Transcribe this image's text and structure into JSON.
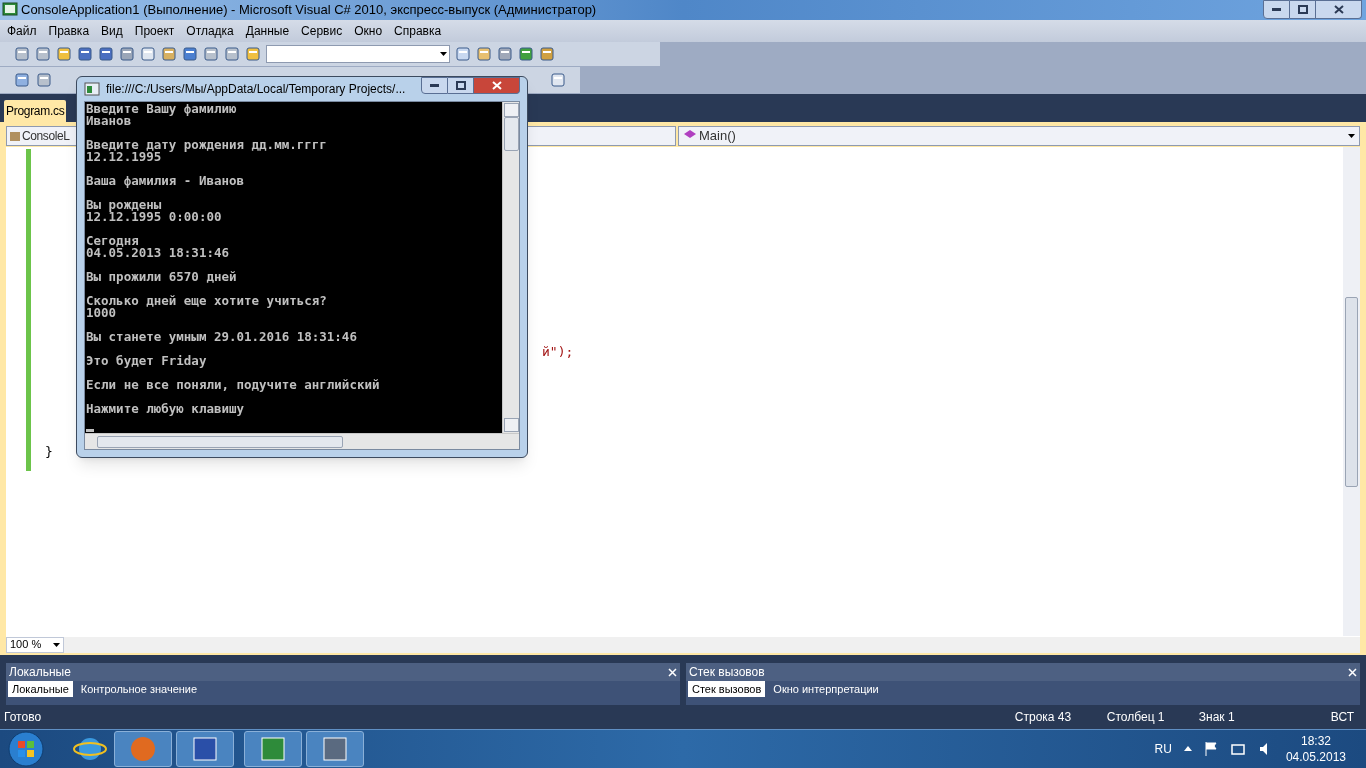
{
  "window": {
    "title": "ConsoleApplication1 (Выполнение) - Microsoft Visual C# 2010, экспресс-выпуск (Администратор)"
  },
  "menu": [
    "Файл",
    "Правка",
    "Вид",
    "Проект",
    "Отладка",
    "Данные",
    "Сервис",
    "Окно",
    "Справка"
  ],
  "doc_tabs": [
    {
      "label": "Program.cs",
      "selected": true
    }
  ],
  "nav_bar": {
    "type_box": "ConsoleL",
    "member_box": "Main()"
  },
  "editor": {
    "fragment": "й\");",
    "brace": "}"
  },
  "zoom": "100 %",
  "panels": [
    {
      "title": "Локальные",
      "tabs": [
        {
          "label": "Локальные",
          "selected": true
        },
        {
          "label": "Контрольное значение",
          "selected": false
        }
      ]
    },
    {
      "title": "Стек вызовов",
      "tabs": [
        {
          "label": "Стек вызовов",
          "selected": true
        },
        {
          "label": "Окно интерпретации",
          "selected": false
        }
      ]
    }
  ],
  "status_bar": {
    "message": "Готово",
    "line": "Строка 43",
    "column": "Столбец 1",
    "char": "Знак 1",
    "mode": "ВСТ"
  },
  "console": {
    "title": "file:///C:/Users/Мы/AppData/Local/Temporary Projects/...",
    "blocks": [
      [
        "Введите Вашу фамилию",
        "Иванов"
      ],
      [
        "Введите дату рождения дд.мм.гггг",
        "12.12.1995"
      ],
      [
        "Ваша фамилия - Иванов"
      ],
      [
        "Вы рождены",
        "12.12.1995 0:00:00"
      ],
      [
        "Сегодня",
        "04.05.2013 18:31:46"
      ],
      [
        "Вы прожили 6570 дней"
      ],
      [
        "Сколько дней еще хотите учиться?",
        "1000"
      ],
      [
        "Вы станете умным 29.01.2016 18:31:46"
      ],
      [
        "Это будет Friday"
      ],
      [
        "Если не все поняли, подучите английский"
      ],
      [
        "Нажмите любую клавишу"
      ]
    ]
  },
  "taskbar": {
    "language": "RU",
    "time": "18:32",
    "date": "04.05.2013"
  }
}
